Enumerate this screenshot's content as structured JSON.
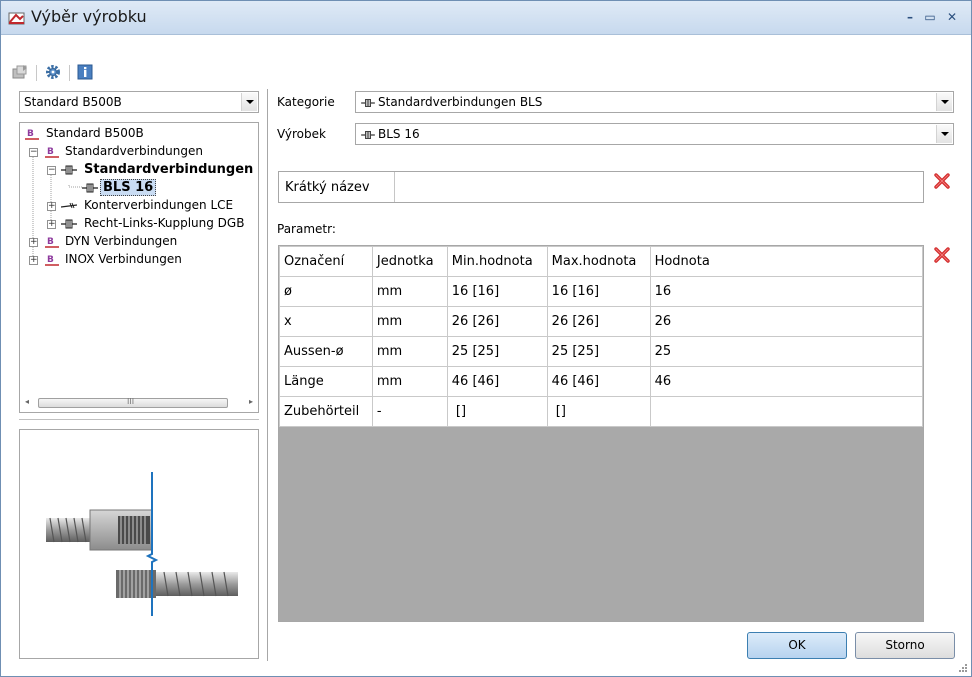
{
  "window": {
    "title": "Výběr výrobku",
    "controls": {
      "minimize": "–",
      "maximize": "▭",
      "close": "✕"
    }
  },
  "toolbar": {
    "items": [
      {
        "icon": "open-folder-icon"
      },
      {
        "icon": "gear-icon"
      },
      {
        "icon": "info-icon"
      }
    ]
  },
  "left": {
    "catalog_select": {
      "value": "Standard B500B"
    },
    "tree": [
      {
        "label": "Standard B500B",
        "level": 0,
        "icon": "catalog-icon",
        "expander": "none"
      },
      {
        "label": "Standardverbindungen",
        "level": 1,
        "icon": "catalog-icon",
        "expander": "minus"
      },
      {
        "label": "Standardverbindungen BL",
        "level": 2,
        "icon": "coupler-icon",
        "expander": "minus",
        "bold": true
      },
      {
        "label": "BLS 16",
        "level": 3,
        "icon": "coupler-icon",
        "expander": "none",
        "bold": true,
        "selected": true
      },
      {
        "label": "Konterverbindungen LCE",
        "level": 2,
        "icon": "rebar-icon",
        "expander": "plus"
      },
      {
        "label": "Recht-Links-Kupplung DGB",
        "level": 2,
        "icon": "coupler-icon",
        "expander": "plus"
      },
      {
        "label": "DYN Verbindungen",
        "level": 1,
        "icon": "catalog-icon",
        "expander": "plus"
      },
      {
        "label": "INOX Verbindungen",
        "level": 1,
        "icon": "catalog-icon",
        "expander": "plus"
      }
    ],
    "scroll_thumb_grip": "III"
  },
  "right": {
    "category_label": "Kategorie",
    "category_value": "Standardverbindungen BLS",
    "product_label": "Výrobek",
    "product_value": "BLS 16",
    "short_name_label": "Krátký název",
    "short_name_value": "",
    "params_label": "Parametr:",
    "params_columns": [
      "Označení",
      "Jednotka",
      "Min.hodnota",
      "Max.hodnota",
      "Hodnota"
    ],
    "params_rows": [
      [
        "ø",
        "mm",
        "16 [16]",
        "16 [16]",
        "16"
      ],
      [
        "x",
        "mm",
        "26 [26]",
        "26 [26]",
        "26"
      ],
      [
        "Aussen-ø",
        "mm",
        "25 [25]",
        "25 [25]",
        "25"
      ],
      [
        "Länge",
        "mm",
        "46 [46]",
        "46 [46]",
        "46"
      ],
      [
        "Zubehörteil",
        "-",
        " []",
        " []",
        ""
      ]
    ]
  },
  "buttons": {
    "ok": "OK",
    "cancel": "Storno"
  },
  "colors": {
    "accent": "#1e73be",
    "delete": "#d22b2b",
    "selection": "#c9dcf3"
  }
}
